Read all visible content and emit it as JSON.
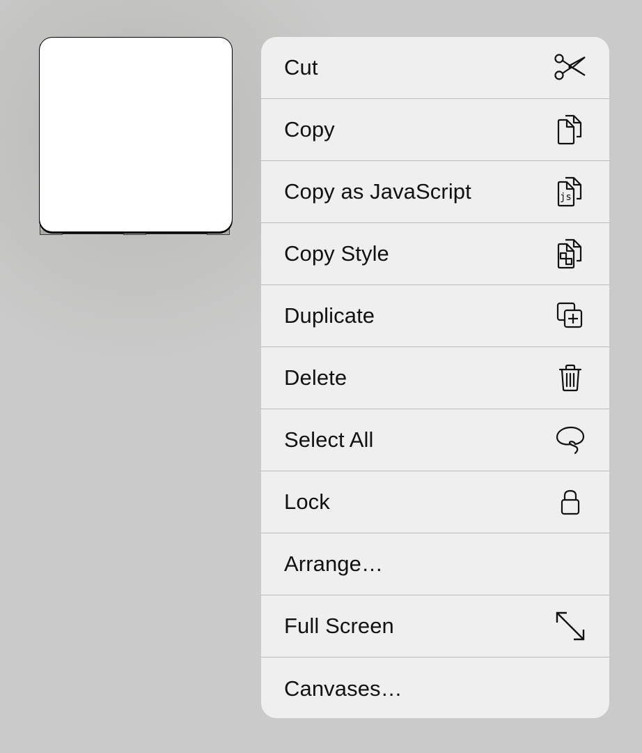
{
  "canvas": {
    "selected_shape": "rounded-rectangle"
  },
  "menu": {
    "items": [
      {
        "label": "Cut",
        "icon": "scissors-icon"
      },
      {
        "label": "Copy",
        "icon": "copy-documents-icon"
      },
      {
        "label": "Copy as JavaScript",
        "icon": "copy-js-icon",
        "icon_text": "js"
      },
      {
        "label": "Copy Style",
        "icon": "copy-style-icon"
      },
      {
        "label": "Duplicate",
        "icon": "duplicate-icon"
      },
      {
        "label": "Delete",
        "icon": "trash-icon"
      },
      {
        "label": "Select All",
        "icon": "lasso-icon"
      },
      {
        "label": "Lock",
        "icon": "lock-icon"
      },
      {
        "label": "Arrange…",
        "icon": null
      },
      {
        "label": "Full Screen",
        "icon": "expand-arrows-icon"
      },
      {
        "label": "Canvases…",
        "icon": null
      }
    ]
  },
  "colors": {
    "menu_background": "#efefef",
    "divider": "#b9b9b9",
    "text": "#111111",
    "canvas_background": "#cacaca"
  }
}
